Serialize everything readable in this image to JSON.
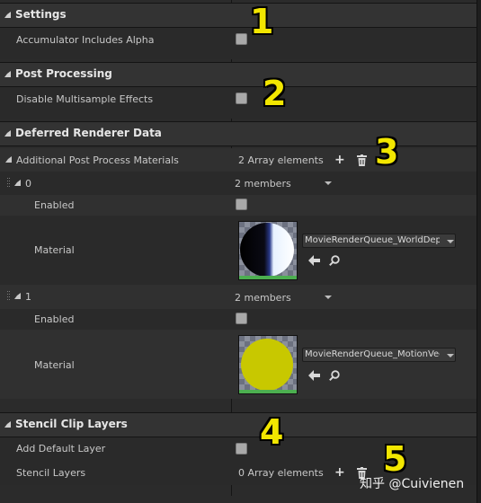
{
  "categories": {
    "settings": "Settings",
    "post_processing": "Post Processing",
    "deferred": "Deferred Renderer Data",
    "stencil": "Stencil Clip Layers"
  },
  "rows": {
    "accumulator": "Accumulator Includes Alpha",
    "disable_msaa": "Disable Multisample Effects",
    "additional_materials": "Additional Post Process Materials",
    "array_count": "2 Array elements",
    "element0_index": "0",
    "element0_members": "2 members",
    "element0_enabled": "Enabled",
    "element0_material": "Material",
    "element0_asset": "MovieRenderQueue_WorldDepth",
    "element1_index": "1",
    "element1_members": "2 members",
    "element1_enabled": "Enabled",
    "element1_material": "Material",
    "element1_asset": "MovieRenderQueue_MotionVectors",
    "add_default_layer": "Add Default Layer",
    "stencil_layers": "Stencil Layers",
    "stencil_count": "0 Array elements"
  },
  "annotations": [
    "1",
    "2",
    "3",
    "4",
    "5"
  ],
  "watermark": "知乎 @Cuivienen",
  "icons": {
    "add": "+",
    "delete": "trash-icon",
    "use_selected": "arrow-left-icon",
    "browse": "search-icon"
  },
  "colors": {
    "annotation": "#f2e600",
    "thumb_bar": "#4caf50",
    "motion_circle": "#c8c800"
  }
}
